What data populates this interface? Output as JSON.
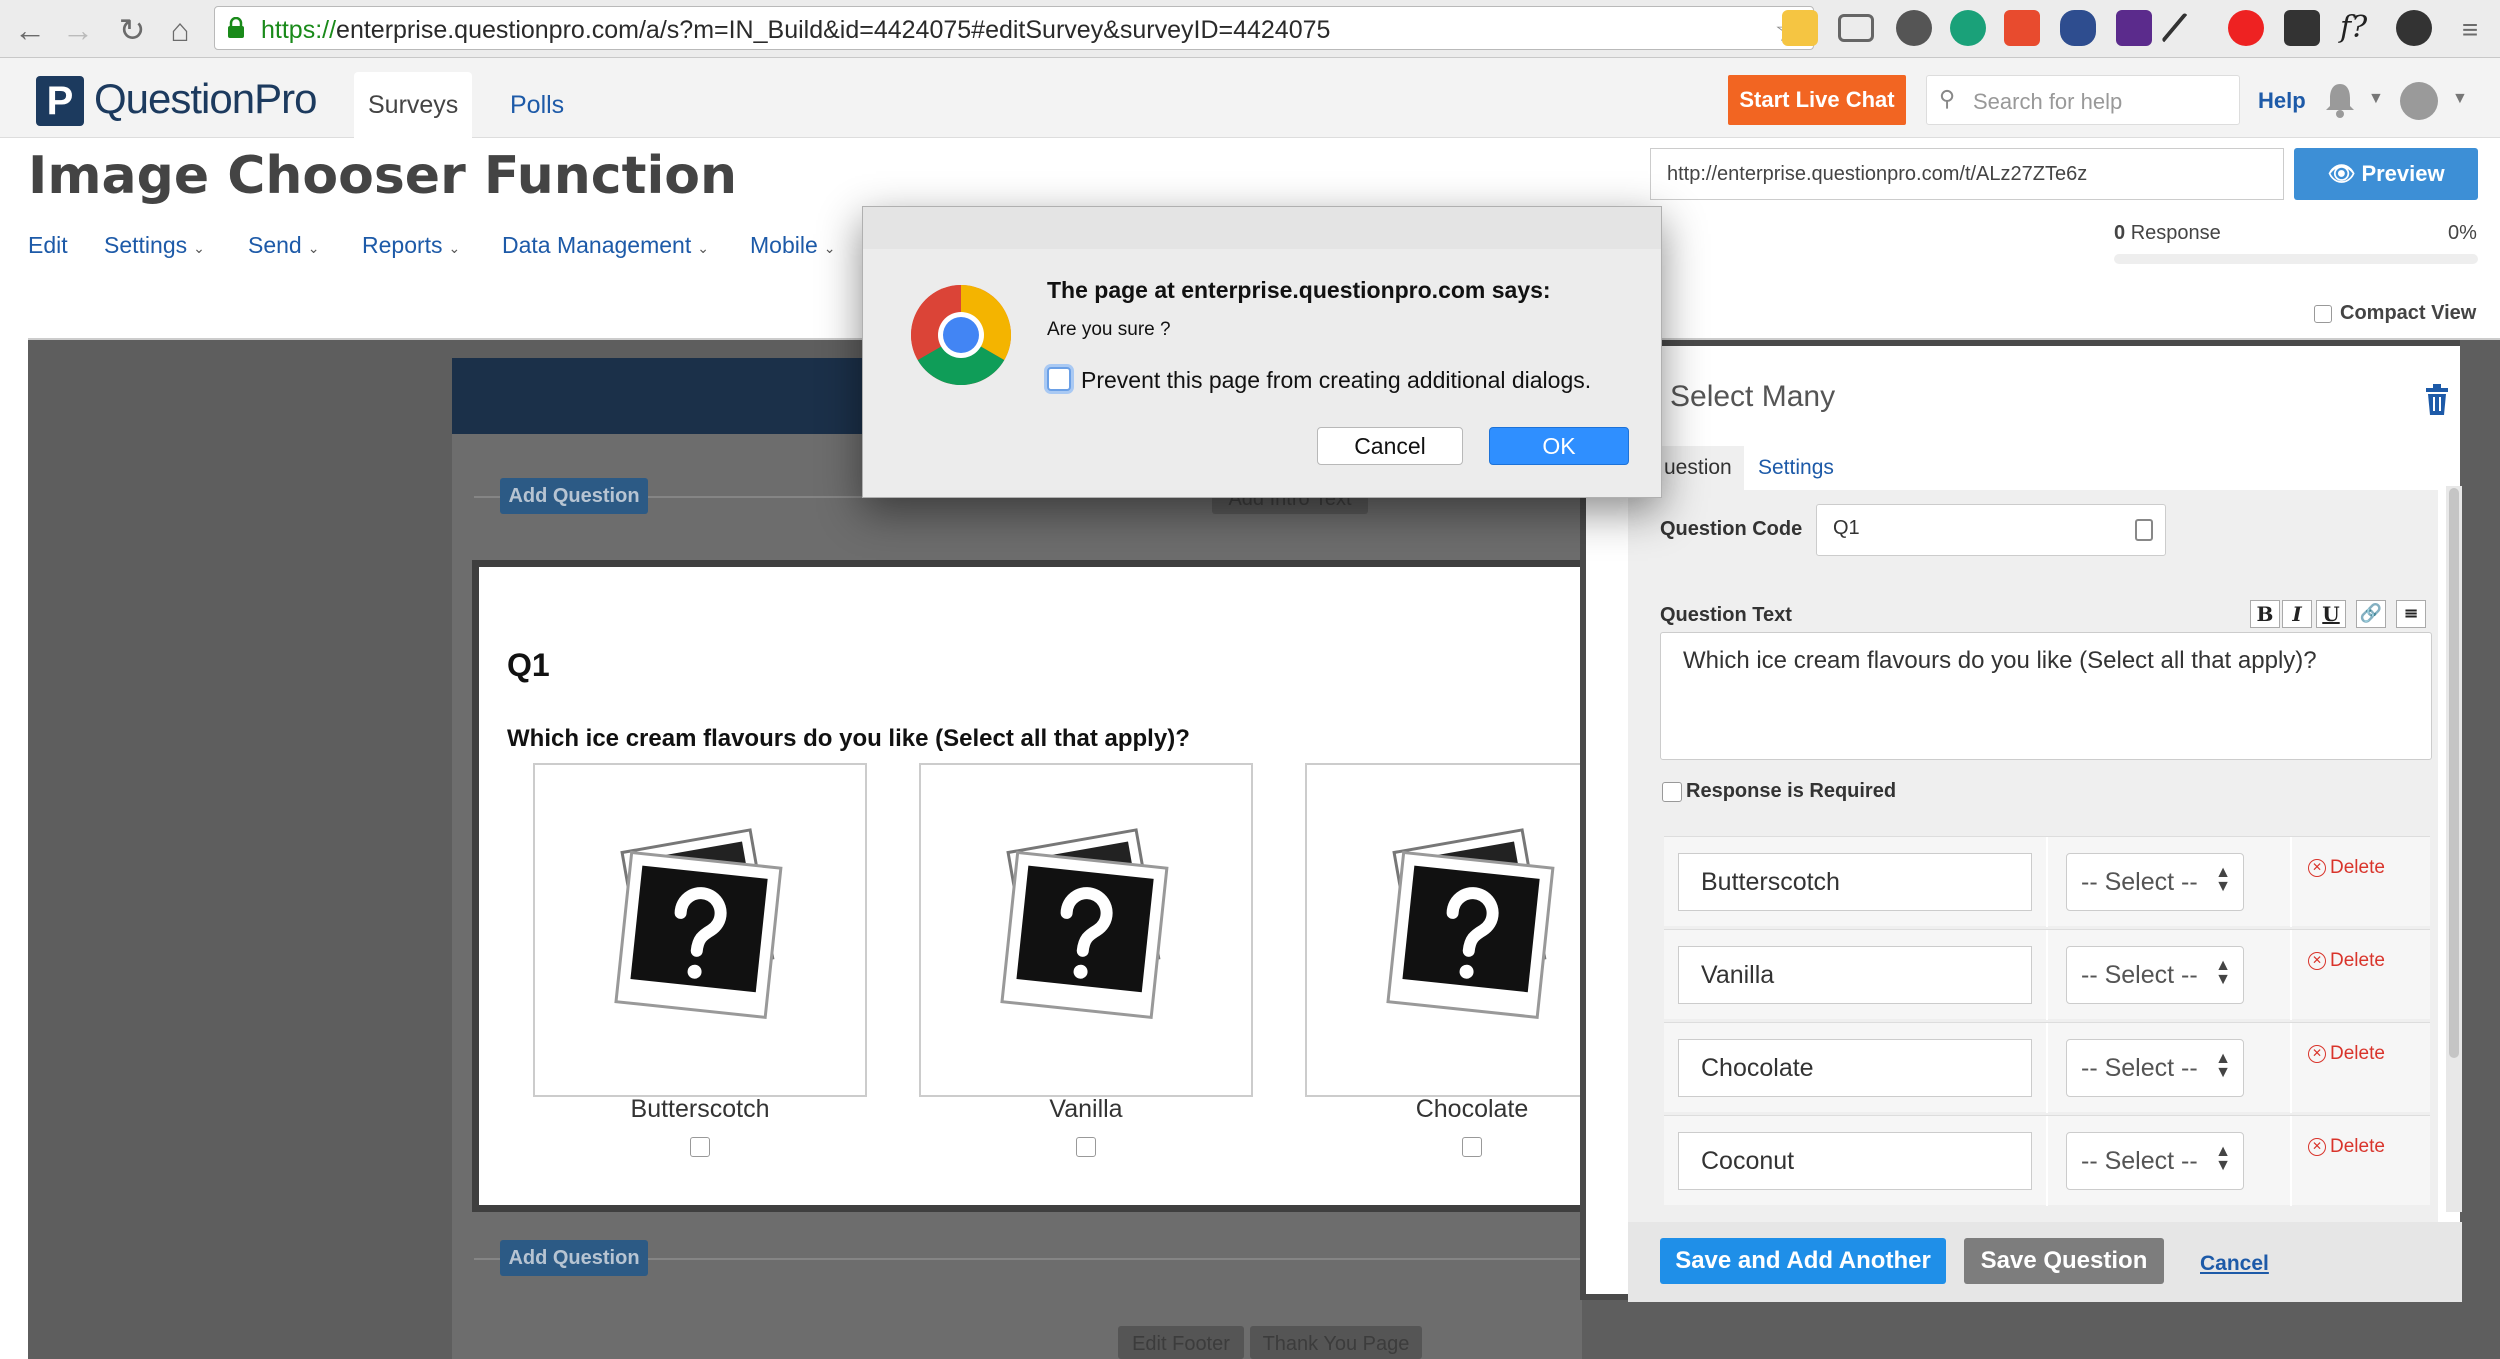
{
  "browser": {
    "url_scheme": "https://",
    "url_rest": "enterprise.questionpro.com/a/s?m=IN_Build&id=4424075#editSurvey&surveyID=4424075"
  },
  "header": {
    "logo_mark": "P",
    "logo_text": "QuestionPro",
    "tabs": [
      {
        "label": "Surveys"
      },
      {
        "label": "Polls"
      }
    ],
    "live_chat_label": "Start Live Chat",
    "search_placeholder": "Search for help",
    "help_label": "Help"
  },
  "page": {
    "title": "Image Chooser Function",
    "survey_url": "http://enterprise.questionpro.com/t/ALz27ZTe6z",
    "preview_label": "Preview",
    "subnav": [
      {
        "label": "Edit"
      },
      {
        "label": "Settings"
      },
      {
        "label": "Send"
      },
      {
        "label": "Reports"
      },
      {
        "label": "Data Management"
      },
      {
        "label": "Mobile"
      }
    ],
    "response_count": "0",
    "response_label": "Response",
    "response_percent": "0%",
    "compact_view_label": "Compact View"
  },
  "editor": {
    "add_question_label": "Add Question",
    "add_intro_label": "Add Intro Text",
    "question_number": "Q1",
    "question_text": "Which ice cream flavours do you like (Select all that apply)?",
    "image_options": [
      {
        "label": "Butterscotch"
      },
      {
        "label": "Vanilla"
      },
      {
        "label": "Chocolate"
      }
    ],
    "edit_footer_label": "Edit Footer",
    "thank_you_label": "Thank You Page"
  },
  "panel": {
    "title": "Select Many",
    "tabs": [
      {
        "label": "uestion"
      },
      {
        "label": "Settings"
      }
    ],
    "question_code_label": "Question Code",
    "question_code_value": "Q1",
    "question_text_label": "Question Text",
    "question_text_value": "Which ice cream flavours do you like (Select all that apply)?",
    "toolbar": [
      "B",
      "I",
      "U"
    ],
    "required_label": "Response is Required",
    "answers": [
      {
        "value": "Butterscotch",
        "select": "-- Select --",
        "delete": "Delete"
      },
      {
        "value": "Vanilla",
        "select": "-- Select --",
        "delete": "Delete"
      },
      {
        "value": "Chocolate",
        "select": "-- Select --",
        "delete": "Delete"
      },
      {
        "value": "Coconut",
        "select": "-- Select --",
        "delete": "Delete"
      }
    ],
    "save_another_label": "Save and Add Another",
    "save_question_label": "Save Question",
    "cancel_label": "Cancel"
  },
  "dialog": {
    "title": "The page at enterprise.questionpro.com says:",
    "message": "Are you sure ?",
    "checkbox_label": "Prevent this page from creating additional dialogs.",
    "cancel_label": "Cancel",
    "ok_label": "OK"
  },
  "colors": {
    "accent_blue": "#1d5aa8",
    "live_chat_orange": "#f26522",
    "primary_button": "#1f8fe8",
    "delete_red": "#d9342b"
  }
}
